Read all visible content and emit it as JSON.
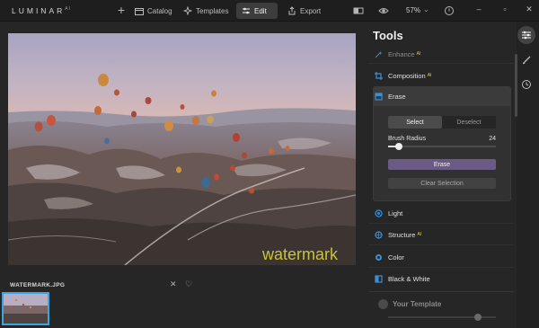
{
  "app": {
    "logo": "LUMINAR",
    "logo_sup": "AI"
  },
  "topbar": {
    "catalog_label": "Catalog",
    "templates_label": "Templates",
    "edit_label": "Edit",
    "export_label": "Export",
    "zoom_value": "57%",
    "zoom_arrow": "⌄"
  },
  "photo": {
    "watermark_text": "watermark"
  },
  "filmstrip": {
    "filename": "WATERMARK.JPG"
  },
  "tools": {
    "title": "Tools",
    "items": [
      {
        "label": "Enhance",
        "badge": "AI"
      },
      {
        "label": "Composition",
        "badge": "AI"
      },
      {
        "label": "Erase",
        "badge": ""
      },
      {
        "label": "Light",
        "badge": ""
      },
      {
        "label": "Structure",
        "badge": "AI"
      },
      {
        "label": "Color",
        "badge": ""
      },
      {
        "label": "Black & White",
        "badge": ""
      }
    ],
    "erase": {
      "select_label": "Select",
      "deselect_label": "Deselect",
      "brush_radius_label": "Brush Radius",
      "brush_radius_value": "24",
      "brush_radius_fraction": 0.1,
      "erase_button": "Erase",
      "clear_button": "Clear Selection"
    },
    "template": {
      "label": "Your Template",
      "slider_fraction": 0.83
    }
  },
  "colors": {
    "accent": "#39a6e0",
    "erase_button": "#6b5a86",
    "ai_badge": "#d8d44a",
    "watermark": "#c9c23a"
  },
  "icons": [
    "plus-icon",
    "catalog-icon",
    "templates-icon",
    "edit-icon",
    "export-icon",
    "compare-icon",
    "eye-icon",
    "undo-icon",
    "minimize-icon",
    "maximize-icon",
    "close-icon",
    "heart-icon",
    "sliders-icon",
    "brush-icon",
    "history-icon"
  ]
}
